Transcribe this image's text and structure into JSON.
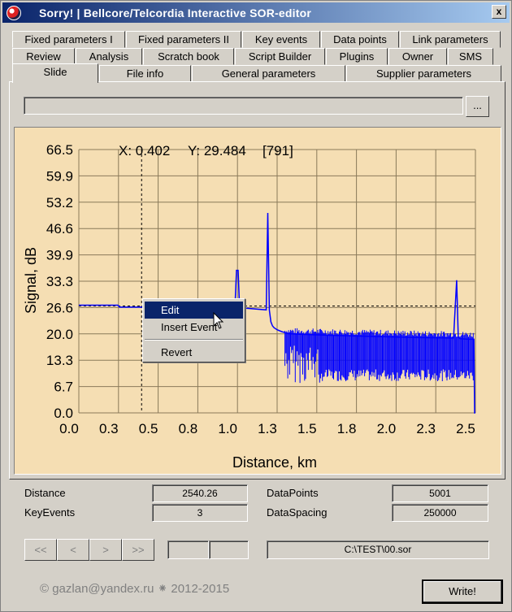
{
  "window": {
    "title": "Sorry!  |  Bellcore/Telcordia Interactive SOR-editor",
    "close_label": "x"
  },
  "tabs_row1": [
    "Fixed parameters I",
    "Fixed parameters II",
    "Key events",
    "Data points",
    "Link parameters"
  ],
  "tabs_row2": [
    "Review",
    "Analysis",
    "Scratch book",
    "Script Builder",
    "Plugins",
    "Owner",
    "SMS"
  ],
  "tabs_row3": [
    "Slide",
    "File info",
    "General parameters",
    "Supplier parameters"
  ],
  "active_tab": "Slide",
  "path_field": {
    "value": ""
  },
  "browse_label": "...",
  "chart_data": {
    "type": "line",
    "readout": {
      "x_label": "X: 0.402",
      "y_label": "Y: 29.484",
      "index_label": "[791]"
    },
    "xlabel": "Distance, km",
    "ylabel": "Signal, dB",
    "xlim": [
      0,
      2.54
    ],
    "ylim": [
      0,
      66.5
    ],
    "x_ticks": [
      "0.0",
      "0.3",
      "0.5",
      "0.8",
      "1.0",
      "1.3",
      "1.5",
      "1.8",
      "2.0",
      "2.3",
      "2.5"
    ],
    "y_ticks": [
      "66.5",
      "59.9",
      "53.2",
      "46.6",
      "39.9",
      "33.3",
      "26.6",
      "20.0",
      "13.3",
      "6.7",
      "0.0"
    ],
    "cursor": {
      "x": 0.402,
      "y": 27.0
    },
    "series": [
      {
        "color": "#0000ff",
        "x": [
          0.0,
          0.25,
          0.26,
          1.0,
          1.01,
          1.02,
          1.03,
          1.04,
          1.05,
          1.08,
          1.2,
          1.21,
          1.22,
          1.23,
          1.24,
          1.25,
          1.27,
          1.3,
          1.35,
          1.45,
          1.6,
          1.8,
          2.0,
          2.2,
          2.4,
          2.42,
          2.43,
          2.44,
          2.45,
          2.5,
          2.53,
          2.535,
          2.54
        ],
        "y": [
          27.2,
          27.2,
          26.7,
          26.7,
          36.0,
          36.0,
          26.0,
          25.9,
          26.4,
          26.4,
          26.0,
          50.5,
          26.0,
          23.0,
          22.0,
          21.5,
          21.0,
          20.5,
          20.0,
          19.8,
          19.6,
          19.4,
          19.2,
          19.0,
          18.9,
          33.5,
          19.0,
          18.8,
          18.7,
          18.6,
          18.6,
          0.0,
          0.0
        ]
      }
    ]
  },
  "context_menu": {
    "items": [
      "Edit",
      "Insert Event",
      "Revert"
    ]
  },
  "info": {
    "distance_label": "Distance",
    "distance_value": "2540.26",
    "keyevents_label": "KeyEvents",
    "keyevents_value": "3",
    "datapoints_label": "DataPoints",
    "datapoints_value": "5001",
    "dataspacing_label": "DataSpacing",
    "dataspacing_value": "250000"
  },
  "nav": {
    "first": "<<",
    "prev": "<",
    "next": ">",
    "last": ">>"
  },
  "file_path": "C:\\TEST\\00.sor",
  "footer": "©  gazlan@yandex.ru  ⁕  2012-2015",
  "write_label": "Write!"
}
